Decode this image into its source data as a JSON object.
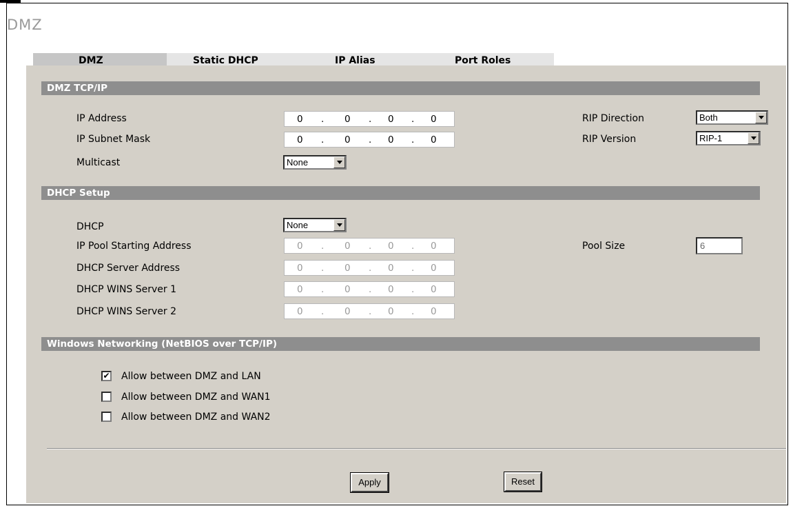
{
  "page_title": "DMZ",
  "tabs": [
    {
      "label": "DMZ",
      "active": true
    },
    {
      "label": "Static DHCP",
      "active": false
    },
    {
      "label": "IP Alias",
      "active": false
    },
    {
      "label": "Port Roles",
      "active": false
    }
  ],
  "dmz_tcpip": {
    "header": "DMZ TCP/IP",
    "ip_address_label": "IP Address",
    "ip_address": [
      "0",
      "0",
      "0",
      "0"
    ],
    "subnet_mask_label": "IP Subnet Mask",
    "subnet_mask": [
      "0",
      "0",
      "0",
      "0"
    ],
    "multicast_label": "Multicast",
    "multicast_value": "None",
    "rip_direction_label": "RIP Direction",
    "rip_direction_value": "Both",
    "rip_version_label": "RIP Version",
    "rip_version_value": "RIP-1"
  },
  "dhcp_setup": {
    "header": "DHCP Setup",
    "dhcp_label": "DHCP",
    "dhcp_value": "None",
    "pool_start_label": "IP Pool Starting Address",
    "pool_start": [
      "0",
      "0",
      "0",
      "0"
    ],
    "server_label": "DHCP Server Address",
    "server": [
      "0",
      "0",
      "0",
      "0"
    ],
    "wins1_label": "DHCP WINS Server 1",
    "wins1": [
      "0",
      "0",
      "0",
      "0"
    ],
    "wins2_label": "DHCP WINS Server 2",
    "wins2": [
      "0",
      "0",
      "0",
      "0"
    ],
    "pool_size_label": "Pool Size",
    "pool_size_value": "6"
  },
  "netbios": {
    "header": "Windows Networking (NetBIOS over TCP/IP)",
    "options": [
      {
        "label": "Allow between DMZ and LAN",
        "checked": true
      },
      {
        "label": "Allow between DMZ and WAN1",
        "checked": false
      },
      {
        "label": "Allow between DMZ and WAN2",
        "checked": false
      }
    ],
    "check_mark": "✔"
  },
  "buttons": {
    "apply": "Apply",
    "reset": "Reset"
  },
  "separator": "."
}
